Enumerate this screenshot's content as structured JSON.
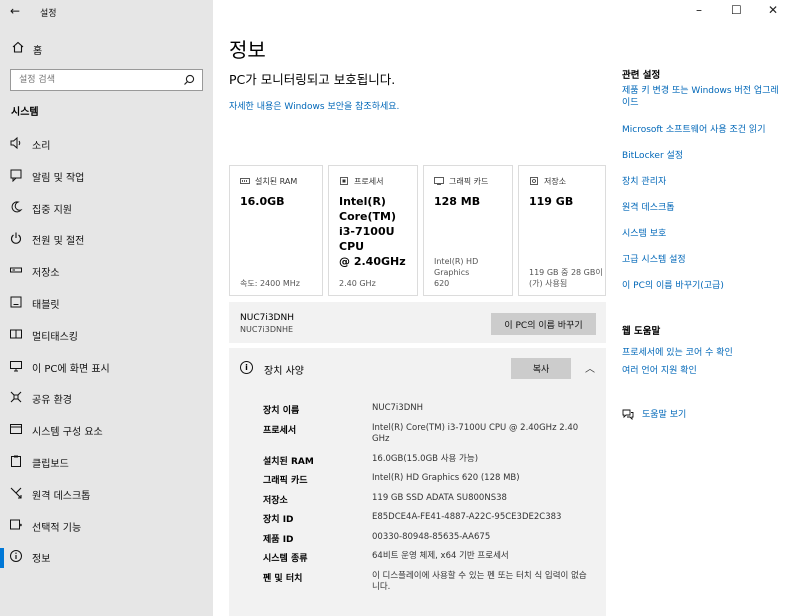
{
  "titlebar": {
    "back": "←",
    "title": "설정"
  },
  "window_controls": {
    "minimize": "–",
    "maximize": "☐",
    "close": "✕"
  },
  "sidebar": {
    "home": "홈",
    "search_placeholder": "설정 검색",
    "section": "시스템",
    "items": [
      {
        "label": "소리",
        "icon": "speaker-icon"
      },
      {
        "label": "알림 및 작업",
        "icon": "notification-icon"
      },
      {
        "label": "집중 지원",
        "icon": "moon-icon"
      },
      {
        "label": "전원 및 절전",
        "icon": "power-icon"
      },
      {
        "label": "저장소",
        "icon": "storage-icon"
      },
      {
        "label": "태블릿",
        "icon": "tablet-icon"
      },
      {
        "label": "멀티태스킹",
        "icon": "multitasking-icon"
      },
      {
        "label": "이 PC에 화면 표시",
        "icon": "project-icon"
      },
      {
        "label": "공유 환경",
        "icon": "share-icon"
      },
      {
        "label": "시스템 구성 요소",
        "icon": "components-icon"
      },
      {
        "label": "클립보드",
        "icon": "clipboard-icon"
      },
      {
        "label": "원격 데스크톱",
        "icon": "remote-desktop-icon"
      },
      {
        "label": "선택적 기능",
        "icon": "optional-features-icon"
      },
      {
        "label": "정보",
        "icon": "info-icon",
        "active": true
      }
    ]
  },
  "main": {
    "title": "정보",
    "protect_message": "PC가 모니터링되고 보호됩니다.",
    "security_link": "자세한 내용은 Windows 보안을 참조하세요.",
    "cards": [
      {
        "header": "설치된 RAM",
        "icon": "ram-icon",
        "value": "16.0GB",
        "footer": "속도: 2400 MHz"
      },
      {
        "header": "프로세서",
        "icon": "cpu-icon",
        "value": "Intel(R)\nCore(TM)\ni3-7100U CPU\n@ 2.40GHz",
        "footer": "2.40 GHz"
      },
      {
        "header": "그래픽 카드",
        "icon": "gpu-icon",
        "value": "128 MB",
        "footer": "Intel(R) HD Graphics\n620"
      },
      {
        "header": "저장소",
        "icon": "drive-icon",
        "value": "119 GB",
        "footer": "119 GB 중 28 GB이\n(가) 사용됨"
      }
    ],
    "pc_name": "NUC7i3DNH",
    "pc_name_sub": "NUC7i3DNHE",
    "rename_button": "이 PC의 이름 바꾸기",
    "spec_header": "장치 사양",
    "copy_button": "복사",
    "specs": [
      {
        "key": "장치 이름",
        "value": "NUC7i3DNH"
      },
      {
        "key": "프로세서",
        "value": "Intel(R) Core(TM) i3-7100U CPU @ 2.40GHz 2.40 GHz"
      },
      {
        "key": "설치된 RAM",
        "value": "16.0GB(15.0GB 사용 가능)"
      },
      {
        "key": "그래픽 카드",
        "value": "Intel(R) HD Graphics 620 (128 MB)"
      },
      {
        "key": "저장소",
        "value": "119 GB SSD ADATA SU800NS38"
      },
      {
        "key": "장치 ID",
        "value": "E85DCE4A-FE41-4887-A22C-95CE3DE2C383"
      },
      {
        "key": "제품 ID",
        "value": "00330-80948-85635-AA675"
      },
      {
        "key": "시스템 종류",
        "value": "64비트 운영 체제, x64 기반 프로세서"
      },
      {
        "key": "펜 및 터치",
        "value": "이 디스플레이에 사용할 수 있는 펜 또는 터치 식 입력이 없습니다."
      }
    ]
  },
  "right": {
    "related_title": "관련 설정",
    "related_links": [
      "제품 키 변경 또는 Windows 버전 업그레이드",
      "Microsoft 소프트웨어 사용 조건 읽기",
      "BitLocker 설정",
      "장치 관리자",
      "원격 데스크톱",
      "시스템 보호",
      "고급 시스템 설정",
      "이 PC의 이름 바꾸기(고급)"
    ],
    "help_title": "웹 도움말",
    "help_links": [
      "프로세서에 있는 코어 수 확인",
      "여러 언어 지원 확인"
    ],
    "get_help": "도움말 보기"
  },
  "colors": {
    "accent": "#0078d7",
    "link": "#0067b8",
    "sidebar_bg": "#e6e6e6"
  }
}
